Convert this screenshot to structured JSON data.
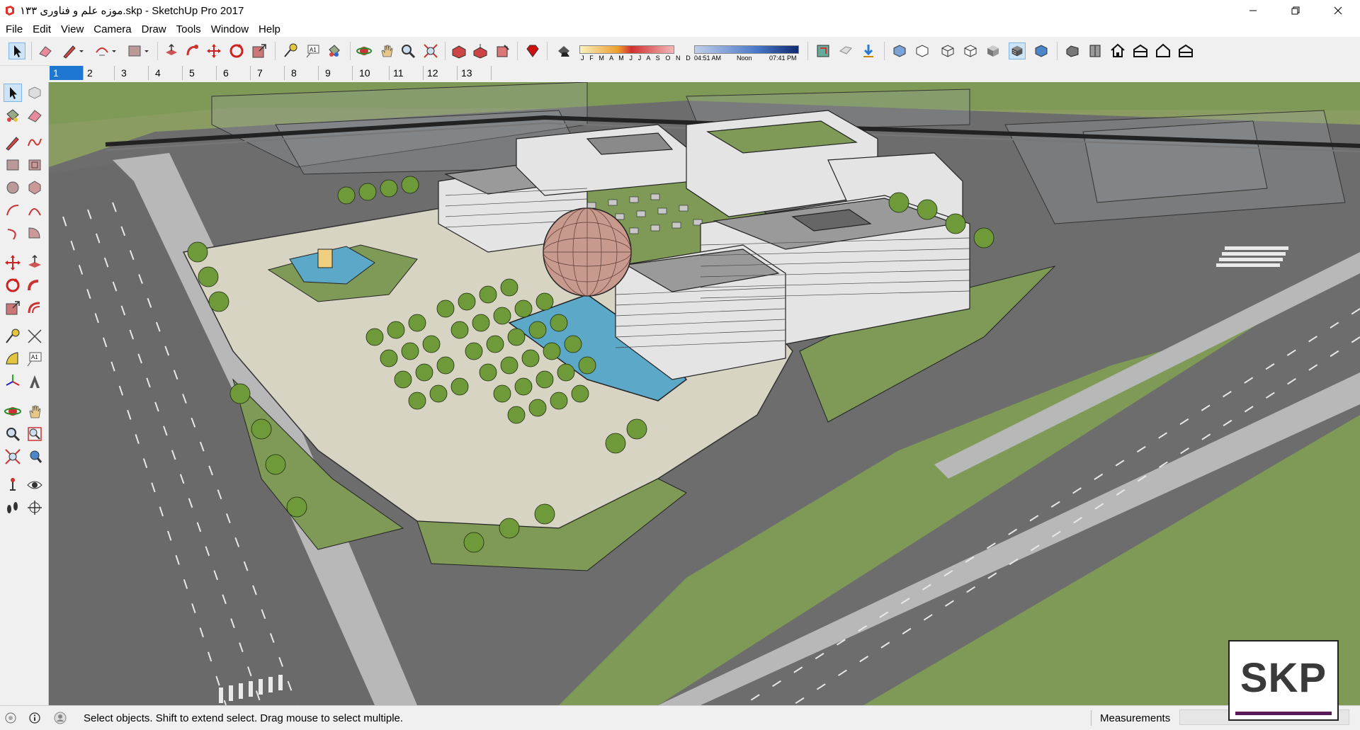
{
  "window": {
    "title": "موزه علم و فناوری ۱۳۳.skp - SketchUp Pro 2017",
    "app_icon": "sketchup-logo-icon",
    "controls": [
      "minimize-icon",
      "restore-icon",
      "close-icon"
    ]
  },
  "menu": [
    "File",
    "Edit",
    "View",
    "Camera",
    "Draw",
    "Tools",
    "Window",
    "Help"
  ],
  "shadow_panel": {
    "months": "J F M A M J J A S O N D",
    "time_start": "04:51 AM",
    "time_mid": "Noon",
    "time_end": "07:41 PM"
  },
  "scenes": [
    "1",
    "2",
    "3",
    "4",
    "5",
    "6",
    "7",
    "8",
    "9",
    "10",
    "11",
    "12",
    "13"
  ],
  "active_scene": "1",
  "status": {
    "message": "Select objects. Shift to extend select. Drag mouse to select multiple.",
    "measurements_label": "Measurements",
    "measurements_value": ""
  },
  "badge": {
    "text": "SKP"
  },
  "colors": {
    "grass": "#7f9a56",
    "asphalt": "#6d6d6d",
    "plaza": "#d8d4c4",
    "water": "#5ba8c8",
    "dome": "#c89a8e",
    "accent": "#1e78d2"
  }
}
